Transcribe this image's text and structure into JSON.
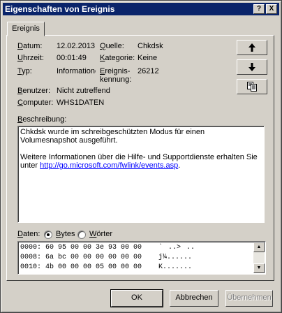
{
  "window": {
    "title": "Eigenschaften von Ereignis",
    "help_btn": "?",
    "close_btn": "X"
  },
  "tab": {
    "label": "Ereignis"
  },
  "fields": {
    "datum_label": "Datum:",
    "datum_value": "12.02.2013",
    "uhrzeit_label": "Uhrzeit:",
    "uhrzeit_value": "00:01:49",
    "typ_label": "Typ:",
    "typ_value": "Informatione",
    "quelle_label": "Quelle:",
    "quelle_value": "Chkdsk",
    "kategorie_label": "Kategorie:",
    "kategorie_value": "Keine",
    "kennung_label_1": "Ereignis-",
    "kennung_label_2": "kennung:",
    "kennung_value": "26212",
    "benutzer_label": "Benutzer:",
    "benutzer_value": "Nicht zutreffend",
    "computer_label": "Computer:",
    "computer_value": "WHS1DATEN"
  },
  "nav": {
    "up_icon": "arrow-up-icon",
    "down_icon": "arrow-down-icon",
    "copy_icon": "copy-icon"
  },
  "description": {
    "label": "Beschreibung:",
    "line1": "Chkdsk wurde im schreibgeschützten Modus für einen Volumesnapshot ausgeführt.",
    "line2": "Weitere Informationen über die Hilfe- und Supportdienste erhalten Sie unter ",
    "link": "http://go.microsoft.com/fwlink/events.asp",
    "after_link": "."
  },
  "data_section": {
    "label": "Daten:",
    "radio_bytes": "Bytes",
    "radio_words": "Wörter",
    "selected": "Bytes",
    "rows": [
      "0000: 60 95 00 00 3e 93 00 00    `..>..",
      "0008: 6a bc 00 00 00 00 00 00    j¼......",
      "0010: 4b 00 00 00 05 00 00 00    K......."
    ]
  },
  "buttons": {
    "ok": "OK",
    "cancel": "Abbrechen",
    "apply": "Übernehmen"
  }
}
